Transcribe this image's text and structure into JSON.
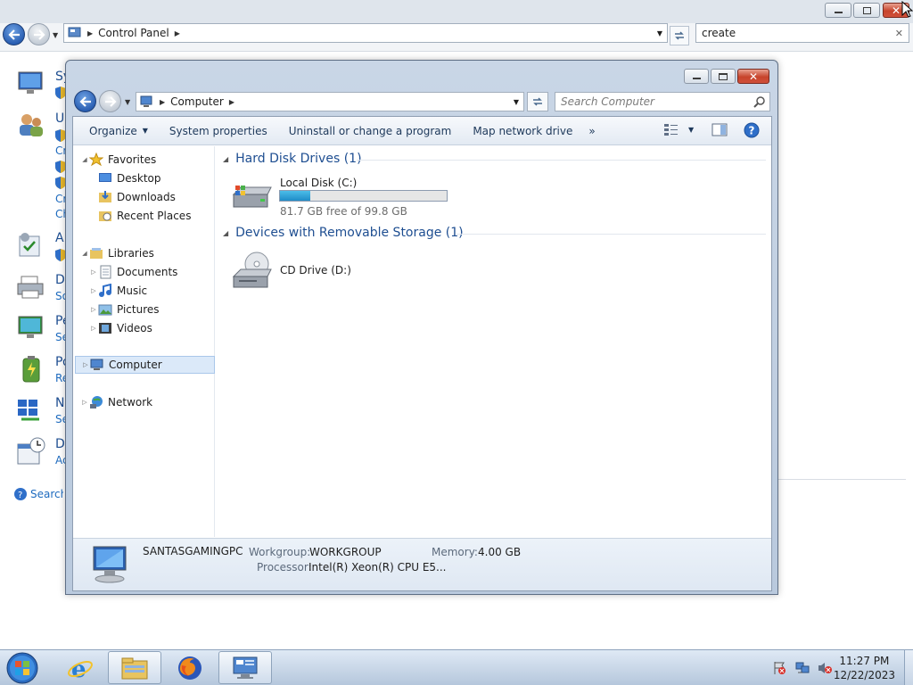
{
  "background_window": {
    "address": {
      "path": [
        "Control Panel"
      ]
    },
    "search": {
      "value": "create"
    },
    "items": [
      {
        "title": "Sy",
        "sub": ""
      },
      {
        "title": "U",
        "sub": "Cr"
      },
      {
        "title": "A",
        "sub": ""
      },
      {
        "title": "D",
        "sub": "So"
      },
      {
        "title": "Pe",
        "sub": "Se"
      },
      {
        "title": "Po",
        "sub": "Re"
      },
      {
        "title": "N",
        "sub": "Se"
      },
      {
        "title": "D",
        "sub": "Ac"
      }
    ],
    "extra_links": [
      "Cr",
      "Cr",
      "Ch"
    ],
    "search_help": "Search W"
  },
  "explorer": {
    "address": {
      "path": [
        "Computer"
      ]
    },
    "search": {
      "placeholder": "Search Computer"
    },
    "toolbar": {
      "organize": "Organize",
      "system_properties": "System properties",
      "uninstall": "Uninstall or change a program",
      "map_drive": "Map network drive",
      "more": "»"
    },
    "nav": {
      "favorites": "Favorites",
      "desktop": "Desktop",
      "downloads": "Downloads",
      "recent": "Recent Places",
      "libraries": "Libraries",
      "documents": "Documents",
      "music": "Music",
      "pictures": "Pictures",
      "videos": "Videos",
      "computer": "Computer",
      "network": "Network"
    },
    "groups": {
      "hdd": "Hard Disk Drives (1)",
      "removable": "Devices with Removable Storage (1)"
    },
    "drives": {
      "c_label": "Local Disk (C:)",
      "c_free": "81.7 GB free of 99.8 GB",
      "c_used_fraction": 0.18,
      "d_label": "CD Drive (D:)"
    },
    "details": {
      "computer_name": "SANTASGAMINGPC",
      "workgroup_label": "Workgroup:",
      "workgroup_value": "WORKGROUP",
      "memory_label": "Memory:",
      "memory_value": "4.00 GB",
      "processor_label": "Processor:",
      "processor_value": "Intel(R) Xeon(R) CPU E5..."
    }
  },
  "taskbar": {
    "time": "11:27 PM",
    "date": "12/22/2023",
    "apps": [
      "start-orb",
      "internet-explorer",
      "windows-explorer",
      "firefox",
      "control-panel"
    ]
  },
  "colors": {
    "link_blue": "#1e4e91",
    "progress_fill": "#1f8cc7",
    "selection": "#dbe9f9"
  }
}
